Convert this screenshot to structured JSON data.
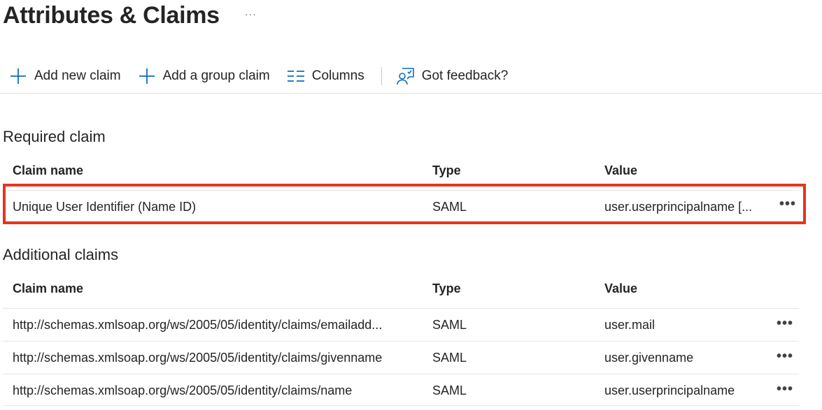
{
  "header": {
    "title": "Attributes & Claims",
    "more_label": "···"
  },
  "toolbar": {
    "add_claim_label": "Add new claim",
    "add_group_label": "Add a group claim",
    "columns_label": "Columns",
    "feedback_label": "Got feedback?"
  },
  "required": {
    "title": "Required claim",
    "columns": [
      "Claim name",
      "Type",
      "Value"
    ],
    "rows": [
      {
        "name": "Unique User Identifier (Name ID)",
        "type": "SAML",
        "value": "user.userprincipalname [..."
      }
    ]
  },
  "additional": {
    "title": "Additional claims",
    "columns": [
      "Claim name",
      "Type",
      "Value"
    ],
    "rows": [
      {
        "name": "http://schemas.xmlsoap.org/ws/2005/05/identity/claims/emailadd...",
        "type": "SAML",
        "value": "user.mail"
      },
      {
        "name": "http://schemas.xmlsoap.org/ws/2005/05/identity/claims/givenname",
        "type": "SAML",
        "value": "user.givenname"
      },
      {
        "name": "http://schemas.xmlsoap.org/ws/2005/05/identity/claims/name",
        "type": "SAML",
        "value": "user.userprincipalname"
      }
    ]
  },
  "row_more_label": "•••",
  "colors": {
    "accent": "#0f6cbd",
    "highlight": "#e8341c"
  }
}
